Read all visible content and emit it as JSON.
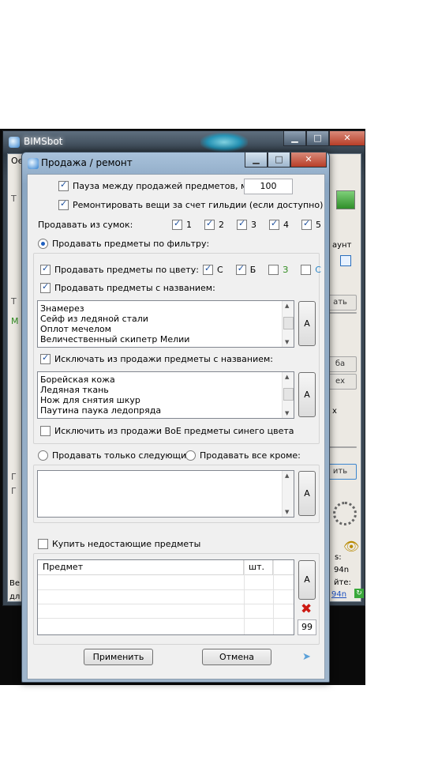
{
  "back_window": {
    "title": "BIMSbot",
    "frag_oi": "Ое",
    "frag_right_1": "аунт",
    "frag_right_2": "ать",
    "frag_right_3": "ба",
    "frag_right_4": "ех",
    "frag_right_5": "х",
    "frag_right_6": "ить",
    "frag_ve": "Ве",
    "frag_dl": "дл",
    "frag_94n_1": "94n",
    "frag_ite": "йте:",
    "frag_94n_2": "94n",
    "frag_s": "s:"
  },
  "dialog": {
    "title": "Продажа / ремонт",
    "pause_label": "Пауза между продажей предметов, мсек",
    "pause_value": "100",
    "repair_label": "Ремонтировать вещи за счет гильдии (если доступно)",
    "bags_label": "Продавать из сумок:",
    "bags": [
      "1",
      "2",
      "3",
      "4",
      "5"
    ],
    "sell_by_filter_label": "Продавать предметы по фильтру:",
    "sell_by_color_label": "Продавать предметы по цвету:",
    "colors": [
      {
        "label": "С",
        "color": "#000000"
      },
      {
        "label": "Б",
        "color": "#000000"
      },
      {
        "label": "З",
        "color": "#2e8b1e"
      },
      {
        "label": "С",
        "color": "#2a86c8"
      }
    ],
    "sell_by_name_label": "Продавать предметы с названием:",
    "sell_names": [
      "Знамерез",
      "Сейф из ледяной стали",
      "Оплот мечелом",
      "Величественный скипетр Мелии"
    ],
    "exclude_by_name_label": "Исключать из продажи предметы с названием:",
    "exclude_names": [
      "Борейская кожа",
      "Ледяная ткань",
      "Нож для снятия шкур",
      "Паутина паука ледопряда"
    ],
    "exclude_boe_label": "Исключить из продажи BoE предметы синего цвета",
    "sell_only_label": "Продавать только следующие:",
    "sell_except_label": "Продавать все кроме:",
    "buy_missing_label": "Купить недостающие предметы",
    "grid_headers": [
      "Предмет",
      "шт."
    ],
    "quantity_value": "99",
    "a_button": "A",
    "apply_button": "Применить",
    "cancel_button": "Отмена"
  },
  "colors": {
    "accent": "#1e5fbf",
    "delete_red": "#cc1a12",
    "arrow_blue": "#5aa0d8"
  }
}
